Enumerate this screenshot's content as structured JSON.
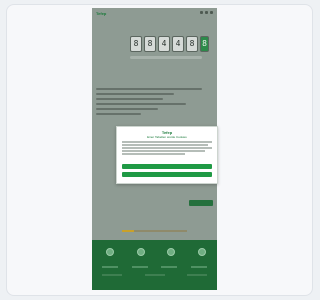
{
  "brand": "Tefep",
  "page": {
    "headline": "",
    "subline": "",
    "counter_digits": [
      "8",
      "8",
      "4",
      "4",
      "8",
      "8"
    ],
    "side_label": ""
  },
  "modal": {
    "logo": "Tefep",
    "title": "Einer Tabellen wurde Cookies",
    "accept_label": "",
    "deny_label": ""
  },
  "footer": {
    "icons": [
      "social-icon",
      "social-icon",
      "social-icon",
      "social-icon"
    ]
  },
  "colors": {
    "brand_green": "#1a7a3a",
    "button_green": "#1f9a45",
    "footer_green": "#1f6a36",
    "overlay_gray": "#8e9b93"
  }
}
